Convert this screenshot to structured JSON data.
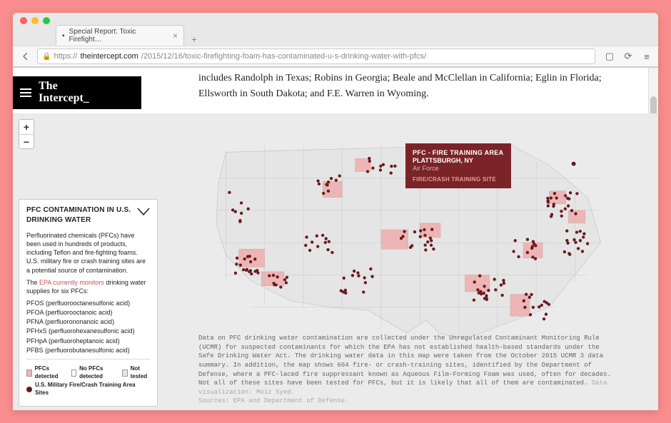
{
  "browser": {
    "tab_title": "Special Report: Toxic Firefight…",
    "url_host": "theintercept.com",
    "url_path": "/2015/12/16/toxic-firefighting-foam-has-contaminated-u-s-drinking-water-with-pfcs/"
  },
  "brand": {
    "line1": "The",
    "line2": "Intercept_"
  },
  "article": {
    "excerpt": "includes Randolph in Texas; Robins in Georgia; Beale and McClellan in California; Eglin in Florida; Ellsworth in South Dakota; and F.E. Warren in Wyoming."
  },
  "map": {
    "zoom_in": "+",
    "zoom_out": "−",
    "tooltip": {
      "title": "PFC - FIRE TRAINING AREA",
      "location": "PLATTSBURGH, NY",
      "branch": "Air Force",
      "type": "FIRE/CRASH TRAINING SITE"
    }
  },
  "info_panel": {
    "title": "PFC CONTAMINATION IN U.S. DRINKING WATER",
    "p1": "Perfluorinated chemicals (PFCs) have been used in hundreds of products, including Teflon and fire-fighting foams. U.S. military fire or crash training sites are a potential source of contamination.",
    "p2_pre": "The ",
    "p2_link": "EPA currently monitors",
    "p2_post": " drinking water supplies for six PFCs:",
    "pfcs": [
      "PFOS (perfluorooctanesulfonic acid)",
      "PFOA (perfluorooctanoic acid)",
      "PFNA (perfluorononanoic acid)",
      "PFHxS (perfluorohexanesulfonic acid)",
      "PFHpA (perfluoroheptanoic acid)",
      "PFBS (perfluorobutanesulfonic acid)"
    ],
    "legend": {
      "detected": "PFCs detected",
      "not_detected": "No PFCs detected",
      "not_tested": "Not tested",
      "military": "U.S. Military Fire/Crash Training Area Sites"
    }
  },
  "caption": {
    "body": "Data on PFC drinking water contamination are collected under the Unregulated Contaminant Monitoring Rule (UCMR) for suspected contaminants for which the EPA has not established health-based standards under the Safe Drinking Water Act. The drinking water data in this map were taken from the October 2015 UCMR 3 data summary. In addition, the map shows 664 fire- or crash-training sites, identified by the Department of Defense, where a PFC-laced fire suppressant known as Aqueous Film-Forming Foam was used, often for decades. Not all of these sites have been tested for PFCs, but it is likely that all of them are contaminated. ",
    "credit1": "Data visualization: Moiz Syed.",
    "credit2": "Sources: EPA and Department of Defense."
  },
  "chart_data": {
    "type": "map",
    "region": "United States (contiguous)",
    "layers": [
      {
        "name": "PFCs detected",
        "fill": "#edb5b5"
      },
      {
        "name": "No PFCs detected",
        "fill": "#ffffff"
      },
      {
        "name": "Not tested",
        "fill": "#e5e5e5"
      }
    ],
    "points": {
      "name": "U.S. Military Fire/Crash Training Area Sites",
      "count": 664,
      "color": "#6b1a1e"
    },
    "highlighted_point": {
      "name": "PFC - FIRE TRAINING AREA",
      "city": "Plattsburgh",
      "state": "NY",
      "branch": "Air Force",
      "site_type": "Fire/Crash Training Site"
    }
  }
}
